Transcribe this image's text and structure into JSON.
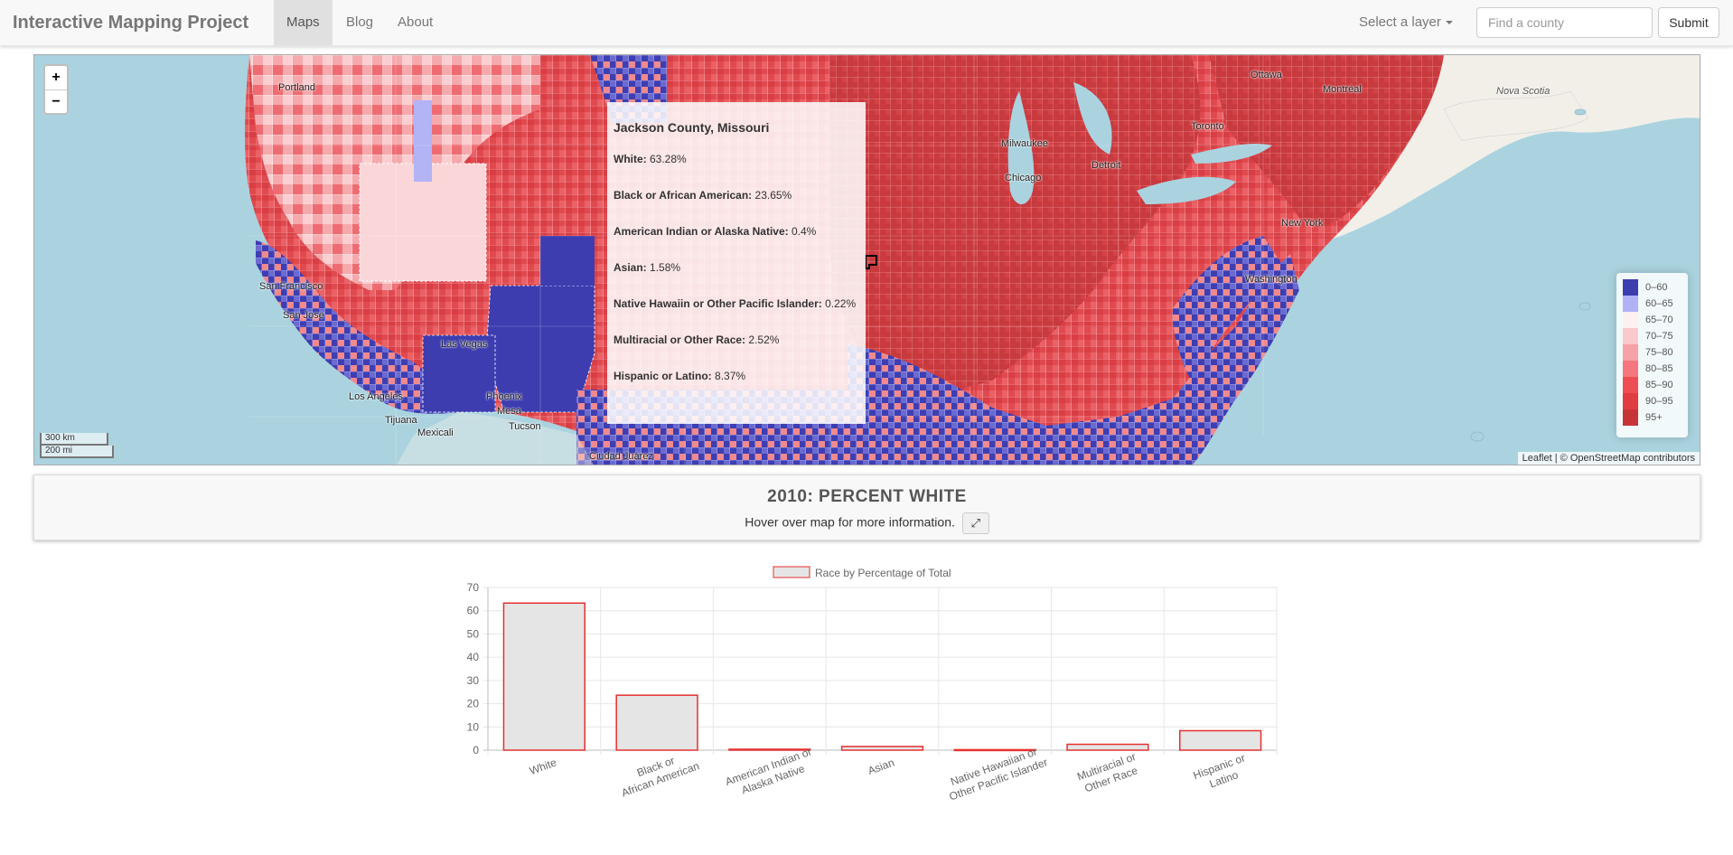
{
  "navbar": {
    "brand": "Interactive Mapping Project",
    "items": [
      {
        "label": "Maps",
        "active": true
      },
      {
        "label": "Blog",
        "active": false
      },
      {
        "label": "About",
        "active": false
      }
    ],
    "layer_select_label": "Select a layer",
    "search_placeholder": "Find a county",
    "submit_label": "Submit"
  },
  "map": {
    "zoom_in": "+",
    "zoom_out": "−",
    "scale_km": "300 km",
    "scale_mi": "200 mi",
    "places": [
      "Ottawa",
      "Montréal",
      "Nova Scotia",
      "Toronto",
      "Chicago",
      "Milwaukee",
      "Detroit",
      "New York",
      "Washington",
      "San Francisco",
      "San Jose",
      "Los Angeles",
      "Las Vegas",
      "Phoenix",
      "Mesa",
      "Tucson",
      "Tijuana",
      "Mexicali",
      "Ciudad Juárez",
      "Portland"
    ],
    "attribution_leaflet": "Leaflet",
    "attribution_sep": " | © ",
    "attribution_osm": "OpenStreetMap contributors",
    "tooltip": {
      "title": "Jackson County, Missouri",
      "rows": [
        {
          "label": "White:",
          "value": "63.28%"
        },
        {
          "label": "Black or African American:",
          "value": "23.65%"
        },
        {
          "label": "American Indian or Alaska Native:",
          "value": "0.4%"
        },
        {
          "label": "Asian:",
          "value": "1.58%"
        },
        {
          "label": "Native Hawaiin or Other Pacific Islander:",
          "value": "0.22%"
        },
        {
          "label": "Multiracial or Other Race:",
          "value": "2.52%"
        },
        {
          "label": "Hispanic or Latino:",
          "value": "8.37%"
        }
      ]
    },
    "legend": [
      {
        "label": "0–60",
        "color": "#3d3db0"
      },
      {
        "label": "60–65",
        "color": "#b1b1f7"
      },
      {
        "label": "65–70",
        "color": "#fdf0f0"
      },
      {
        "label": "70–75",
        "color": "#fbc8cb"
      },
      {
        "label": "75–80",
        "color": "#f6a2a6"
      },
      {
        "label": "80–85",
        "color": "#f3777c"
      },
      {
        "label": "85–90",
        "color": "#ee4d53"
      },
      {
        "label": "90–95",
        "color": "#e03c41"
      },
      {
        "label": "95+",
        "color": "#c73438"
      }
    ]
  },
  "info": {
    "title": "2010: PERCENT WHITE",
    "subtitle": "Hover over map for more information.",
    "expand_icon": "⤢"
  },
  "chart_data": {
    "type": "bar",
    "legend": "Race by Percentage of Total",
    "categories": [
      [
        "White"
      ],
      [
        "Black or",
        "African American"
      ],
      [
        "American Indian or",
        "Alaska Native"
      ],
      [
        "Asian"
      ],
      [
        "Native Hawaiian or",
        "Other Pacific Islander"
      ],
      [
        "Multiracial or",
        "Other Race"
      ],
      [
        "Hispanic or",
        "Latino"
      ]
    ],
    "values": [
      63.28,
      23.65,
      0.4,
      1.58,
      0.22,
      2.52,
      8.37
    ],
    "yticks": [
      0,
      10,
      20,
      30,
      40,
      50,
      60,
      70
    ],
    "ylim": [
      0,
      70
    ],
    "bar_fill": "#e5e5e5",
    "bar_stroke": "#e53030"
  }
}
